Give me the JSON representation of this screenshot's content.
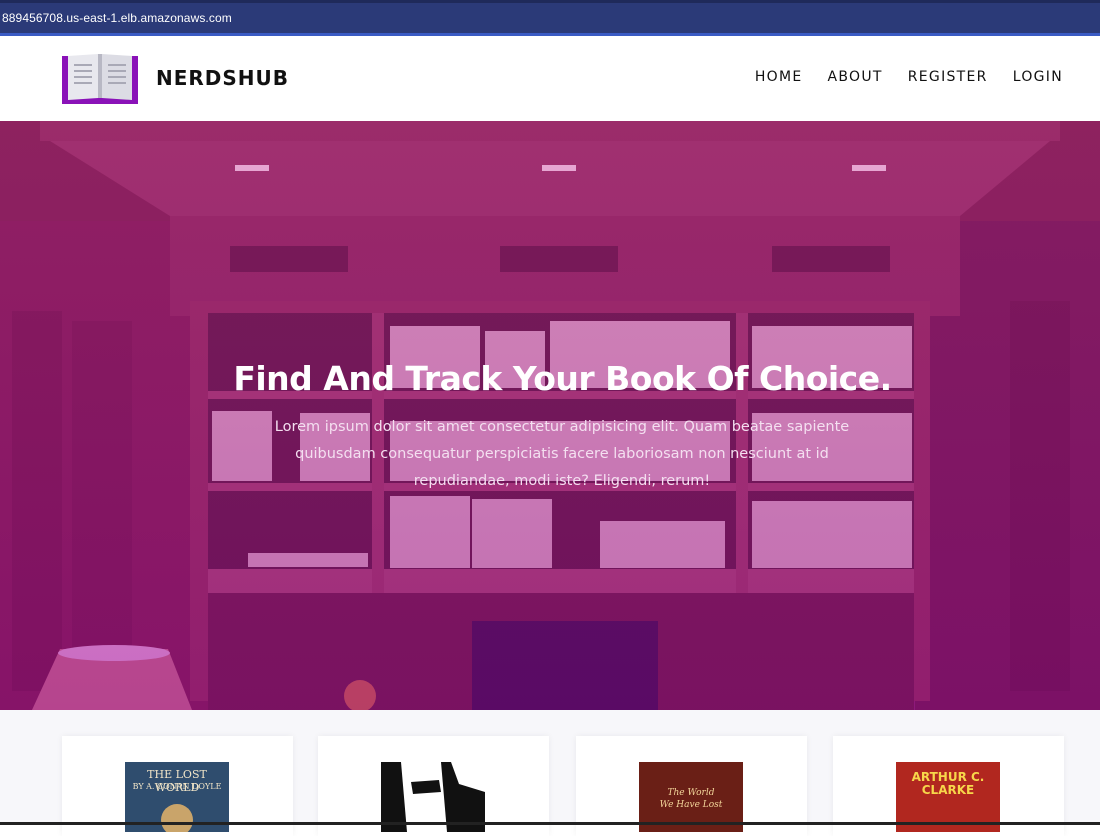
{
  "browser": {
    "url": "889456708.us-east-1.elb.amazonaws.com"
  },
  "navbar": {
    "brand": "NERDSHUB",
    "logo_icon": "open-book-icon",
    "links": [
      {
        "label": "HOME"
      },
      {
        "label": "ABOUT"
      },
      {
        "label": "REGISTER"
      },
      {
        "label": "LOGIN"
      }
    ]
  },
  "hero": {
    "title": "Find And Track Your Book Of Choice.",
    "text": "Lorem ipsum dolor sit amet consectetur adipisicing elit. Quam beatae sapiente quibusdam consequatur perspiciatis facere laboriosam non nesciunt at id repudiandae, modi iste? Eligendi, rerum!"
  },
  "books": [
    {
      "cover_line1": "THE LOST WORLD",
      "cover_line2": "BY A. CONAN DOYLE"
    },
    {
      "cover_line1": "",
      "cover_line2": ""
    },
    {
      "cover_line1": "The World",
      "cover_line2": "We Have Lost"
    },
    {
      "cover_line1": "ARTHUR C.",
      "cover_line2": "CLARKE"
    }
  ],
  "colors": {
    "brand_purple": "#8a12b8",
    "hero_tint": "#a0207c",
    "url_bar": "#2b3a78"
  }
}
